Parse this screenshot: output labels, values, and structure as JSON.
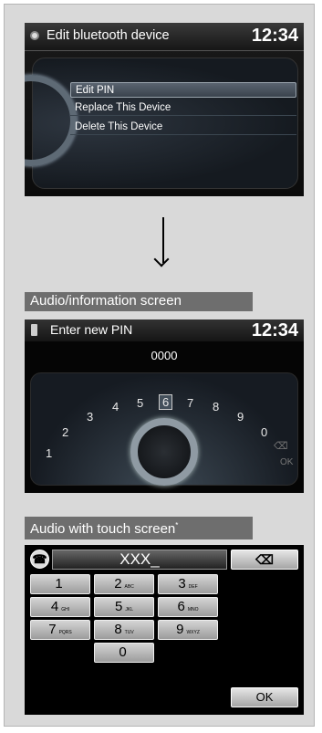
{
  "screen1": {
    "title": "Edit bluetooth device",
    "clock": "12:34",
    "menu": [
      "Edit PIN",
      "Replace This Device",
      "Delete This Device"
    ]
  },
  "label_audio_info": "Audio/information screen",
  "screen2": {
    "title": "Enter new PIN",
    "clock": "12:34",
    "pin_value": "0000",
    "dial_digits": [
      "1",
      "2",
      "3",
      "4",
      "5",
      "6",
      "7",
      "8",
      "9",
      "0"
    ],
    "selected_digit": "6",
    "ok_label": "OK"
  },
  "label_touch": "Audio with touch screen",
  "label_touch_mark": "*",
  "screen3": {
    "entry": "XXX_",
    "keys": [
      {
        "num": "1",
        "sub": ""
      },
      {
        "num": "2",
        "sub": "ABC"
      },
      {
        "num": "3",
        "sub": "DEF"
      },
      {
        "num": "4",
        "sub": "GHI"
      },
      {
        "num": "5",
        "sub": "JKL"
      },
      {
        "num": "6",
        "sub": "MNO"
      },
      {
        "num": "7",
        "sub": "PQRS"
      },
      {
        "num": "8",
        "sub": "TUV"
      },
      {
        "num": "9",
        "sub": "WXYZ"
      },
      {
        "num": "0",
        "sub": ""
      }
    ],
    "ok_label": "OK",
    "delete_glyph": "⌫",
    "phone_glyph": "☎"
  }
}
